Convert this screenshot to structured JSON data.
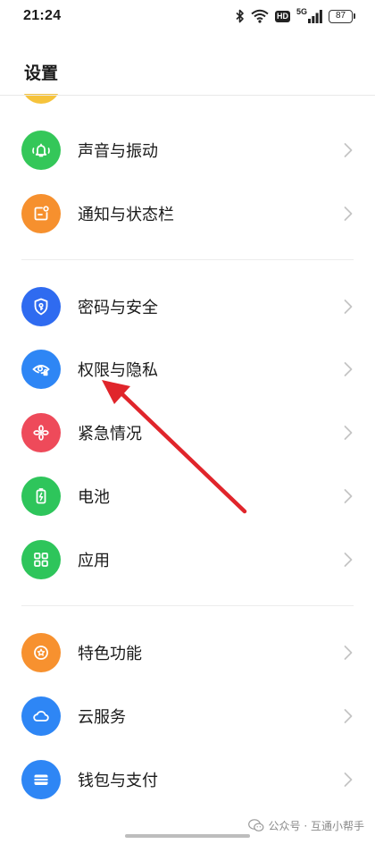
{
  "status_bar": {
    "time": "21:24",
    "hd": "HD",
    "network": "5G",
    "battery": "87"
  },
  "header": {
    "title": "设置"
  },
  "menu": {
    "items": [
      {
        "label": "声音与振动",
        "icon": "bell-vibrate-icon",
        "color": "#34c759"
      },
      {
        "label": "通知与状态栏",
        "icon": "notification-icon",
        "color": "#f6902e"
      },
      {
        "label": "密码与安全",
        "icon": "shield-key-icon",
        "color": "#2f6bf0"
      },
      {
        "label": "权限与隐私",
        "icon": "privacy-eye-icon",
        "color": "#2e86f5"
      },
      {
        "label": "紧急情况",
        "icon": "emergency-icon",
        "color": "#ee4a5a"
      },
      {
        "label": "电池",
        "icon": "battery-icon",
        "color": "#2ec55b"
      },
      {
        "label": "应用",
        "icon": "apps-grid-icon",
        "color": "#2ec55b"
      },
      {
        "label": "特色功能",
        "icon": "star-badge-icon",
        "color": "#f7912f"
      },
      {
        "label": "云服务",
        "icon": "cloud-icon",
        "color": "#2e86f5"
      },
      {
        "label": "钱包与支付",
        "icon": "wallet-icon",
        "color": "#2e86f5"
      }
    ]
  },
  "annotation": {
    "arrow_color": "#e0252b",
    "points_to": "权限与隐私"
  },
  "watermark": {
    "text": "公众号 · 互通小帮手"
  }
}
